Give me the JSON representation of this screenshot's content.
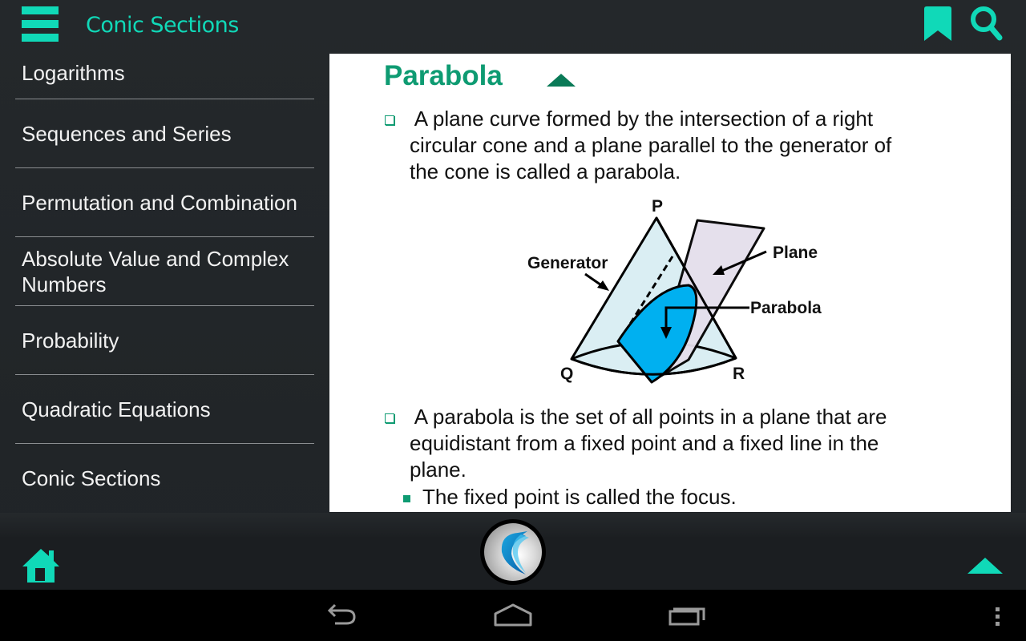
{
  "header": {
    "title": "Conic Sections",
    "menu_icon": "hamburger-menu-icon",
    "bookmark_icon": "bookmark-icon",
    "search_icon": "search-icon"
  },
  "sidebar": {
    "items": [
      {
        "label": "Logarithms"
      },
      {
        "label": "Sequences and Series"
      },
      {
        "label": "Permutation and Combination"
      },
      {
        "label": "Absolute Value and Complex Numbers"
      },
      {
        "label": "Probability"
      },
      {
        "label": "Quadratic Equations"
      },
      {
        "label": "Conic Sections"
      }
    ]
  },
  "content": {
    "section_title": "Parabola",
    "collapse_icon": "triangle-up-icon",
    "paragraphs": [
      {
        "lines": [
          " A plane curve formed by the intersection of a right",
          "circular cone and a plane parallel to the generator of",
          "the cone is called a parabola."
        ]
      },
      {
        "lines": [
          " A parabola is the set of all points in a plane that are",
          "equidistant from a fixed point and a fixed line in the",
          "plane."
        ]
      }
    ],
    "sub_bullets": [
      "The fixed point is called the focus."
    ],
    "diagram": {
      "labels": {
        "apex": "P",
        "left_base": "Q",
        "right_base": "R",
        "generator": "Generator",
        "plane": "Plane",
        "parabola": "Parabola"
      },
      "colors": {
        "cone_fill": "#daeef3",
        "plane_fill": "#e4dfec",
        "parabola_fill": "#00b0f0"
      }
    }
  },
  "bottom_bar": {
    "home_icon": "home-icon",
    "logo_icon": "app-logo-icon",
    "scroll_top_icon": "triangle-up-icon"
  },
  "system_nav": {
    "back_icon": "back-icon",
    "home_icon": "home-outline-icon",
    "recents_icon": "recent-apps-icon",
    "overflow_icon": "overflow-menu-icon"
  },
  "theme": {
    "accent": "#10d9b8",
    "heading_green": "#0e9b72",
    "background": "#222629"
  }
}
